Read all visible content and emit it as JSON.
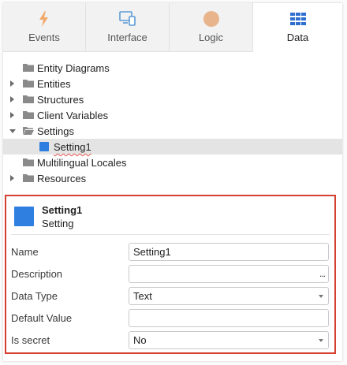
{
  "tabs": [
    {
      "label": "Events",
      "icon": "lightning-icon",
      "color": "#f0a86b"
    },
    {
      "label": "Interface",
      "icon": "screens-icon",
      "color": "#5b9bd5"
    },
    {
      "label": "Logic",
      "icon": "circle-icon",
      "color": "#e8b48c"
    },
    {
      "label": "Data",
      "icon": "grid-table-icon",
      "color": "#2f6fd0"
    }
  ],
  "active_tab": "Data",
  "tree": {
    "items": [
      {
        "label": "Entity Diagrams",
        "expand": "none"
      },
      {
        "label": "Entities",
        "expand": "collapsed"
      },
      {
        "label": "Structures",
        "expand": "collapsed"
      },
      {
        "label": "Client Variables",
        "expand": "collapsed"
      },
      {
        "label": "Settings",
        "expand": "expanded"
      },
      {
        "label": "Setting1",
        "expand": "none",
        "child": true,
        "selected": true
      },
      {
        "label": "Multilingual Locales",
        "expand": "none"
      },
      {
        "label": "Resources",
        "expand": "collapsed"
      }
    ]
  },
  "properties": {
    "title": "Setting1",
    "subtitle": "Setting",
    "rows": [
      {
        "label": "Name",
        "value": "Setting1",
        "kind": "text"
      },
      {
        "label": "Description",
        "value": "",
        "kind": "text-more",
        "more": "..."
      },
      {
        "label": "Data Type",
        "value": "Text",
        "kind": "select"
      },
      {
        "label": "Default Value",
        "value": "",
        "kind": "text"
      },
      {
        "label": "Is secret",
        "value": "No",
        "kind": "select"
      }
    ]
  },
  "colors": {
    "selection_border": "#d64031",
    "setting_icon": "#2f7fe0",
    "folder": "#8a8a8a"
  }
}
